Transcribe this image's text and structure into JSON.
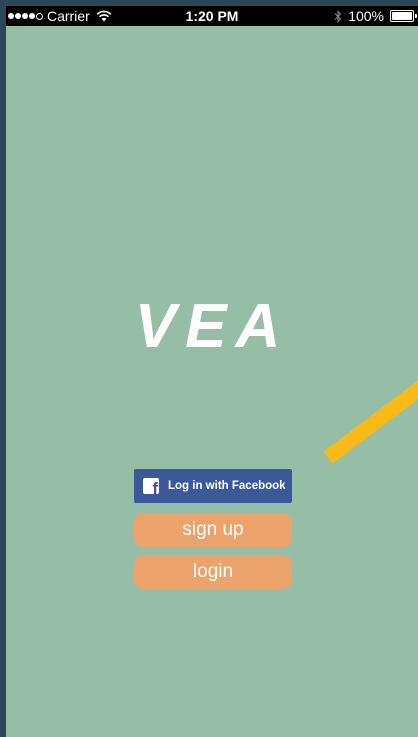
{
  "status_bar": {
    "carrier": "Carrier",
    "time": "1:20 PM",
    "battery": "100%",
    "signal_bars": 4,
    "signal_max": 5
  },
  "app": {
    "logo_text": "VEA"
  },
  "buttons": {
    "facebook_label": "Log in with Facebook",
    "signup_label": "sign up",
    "login_label": "login"
  },
  "colors": {
    "background": "#96bea7",
    "facebook_blue": "#3b5998",
    "pill_orange": "#eba26b",
    "accent_yellow": "#f9b916",
    "frame": "#2c4654"
  },
  "icons": {
    "facebook": "facebook-icon",
    "wifi": "wifi-icon",
    "bluetooth": "bluetooth-icon",
    "battery": "battery-icon"
  }
}
